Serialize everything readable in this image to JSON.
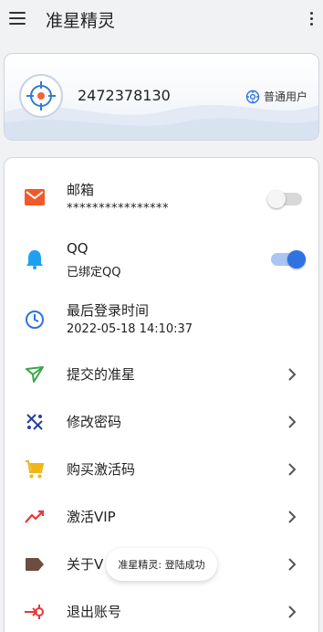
{
  "appbar": {
    "title": "准星精灵"
  },
  "profile": {
    "user_id": "2472378130",
    "user_type": "普通用户"
  },
  "items": [
    {
      "label": "邮箱",
      "sub": "****************",
      "icon": "mail-icon",
      "color": "#f05a28",
      "toggle": "off"
    },
    {
      "label": "QQ",
      "sub": "已绑定QQ",
      "icon": "qq-bell-icon",
      "color": "#1ea0f2",
      "toggle": "on"
    },
    {
      "label": "最后登录时间",
      "sub": "2022-05-18 14:10:37",
      "icon": "clock-icon",
      "color": "#2f72e0"
    },
    {
      "label": "提交的准星",
      "icon": "send-icon",
      "color": "#3aa64b"
    },
    {
      "label": "修改密码",
      "icon": "password-icon",
      "color": "#2b3f9e"
    },
    {
      "label": "购买激活码",
      "icon": "cart-icon",
      "color": "#f2b517"
    },
    {
      "label": "激活VIP",
      "icon": "trend-icon",
      "color": "#e53935"
    },
    {
      "label": "关于V",
      "icon": "tag-icon",
      "color": "#6d4c41"
    },
    {
      "label": "退出账号",
      "icon": "logout-icon",
      "color": "#e53935"
    }
  ],
  "toast": {
    "message": "准星精灵: 登陆成功"
  }
}
